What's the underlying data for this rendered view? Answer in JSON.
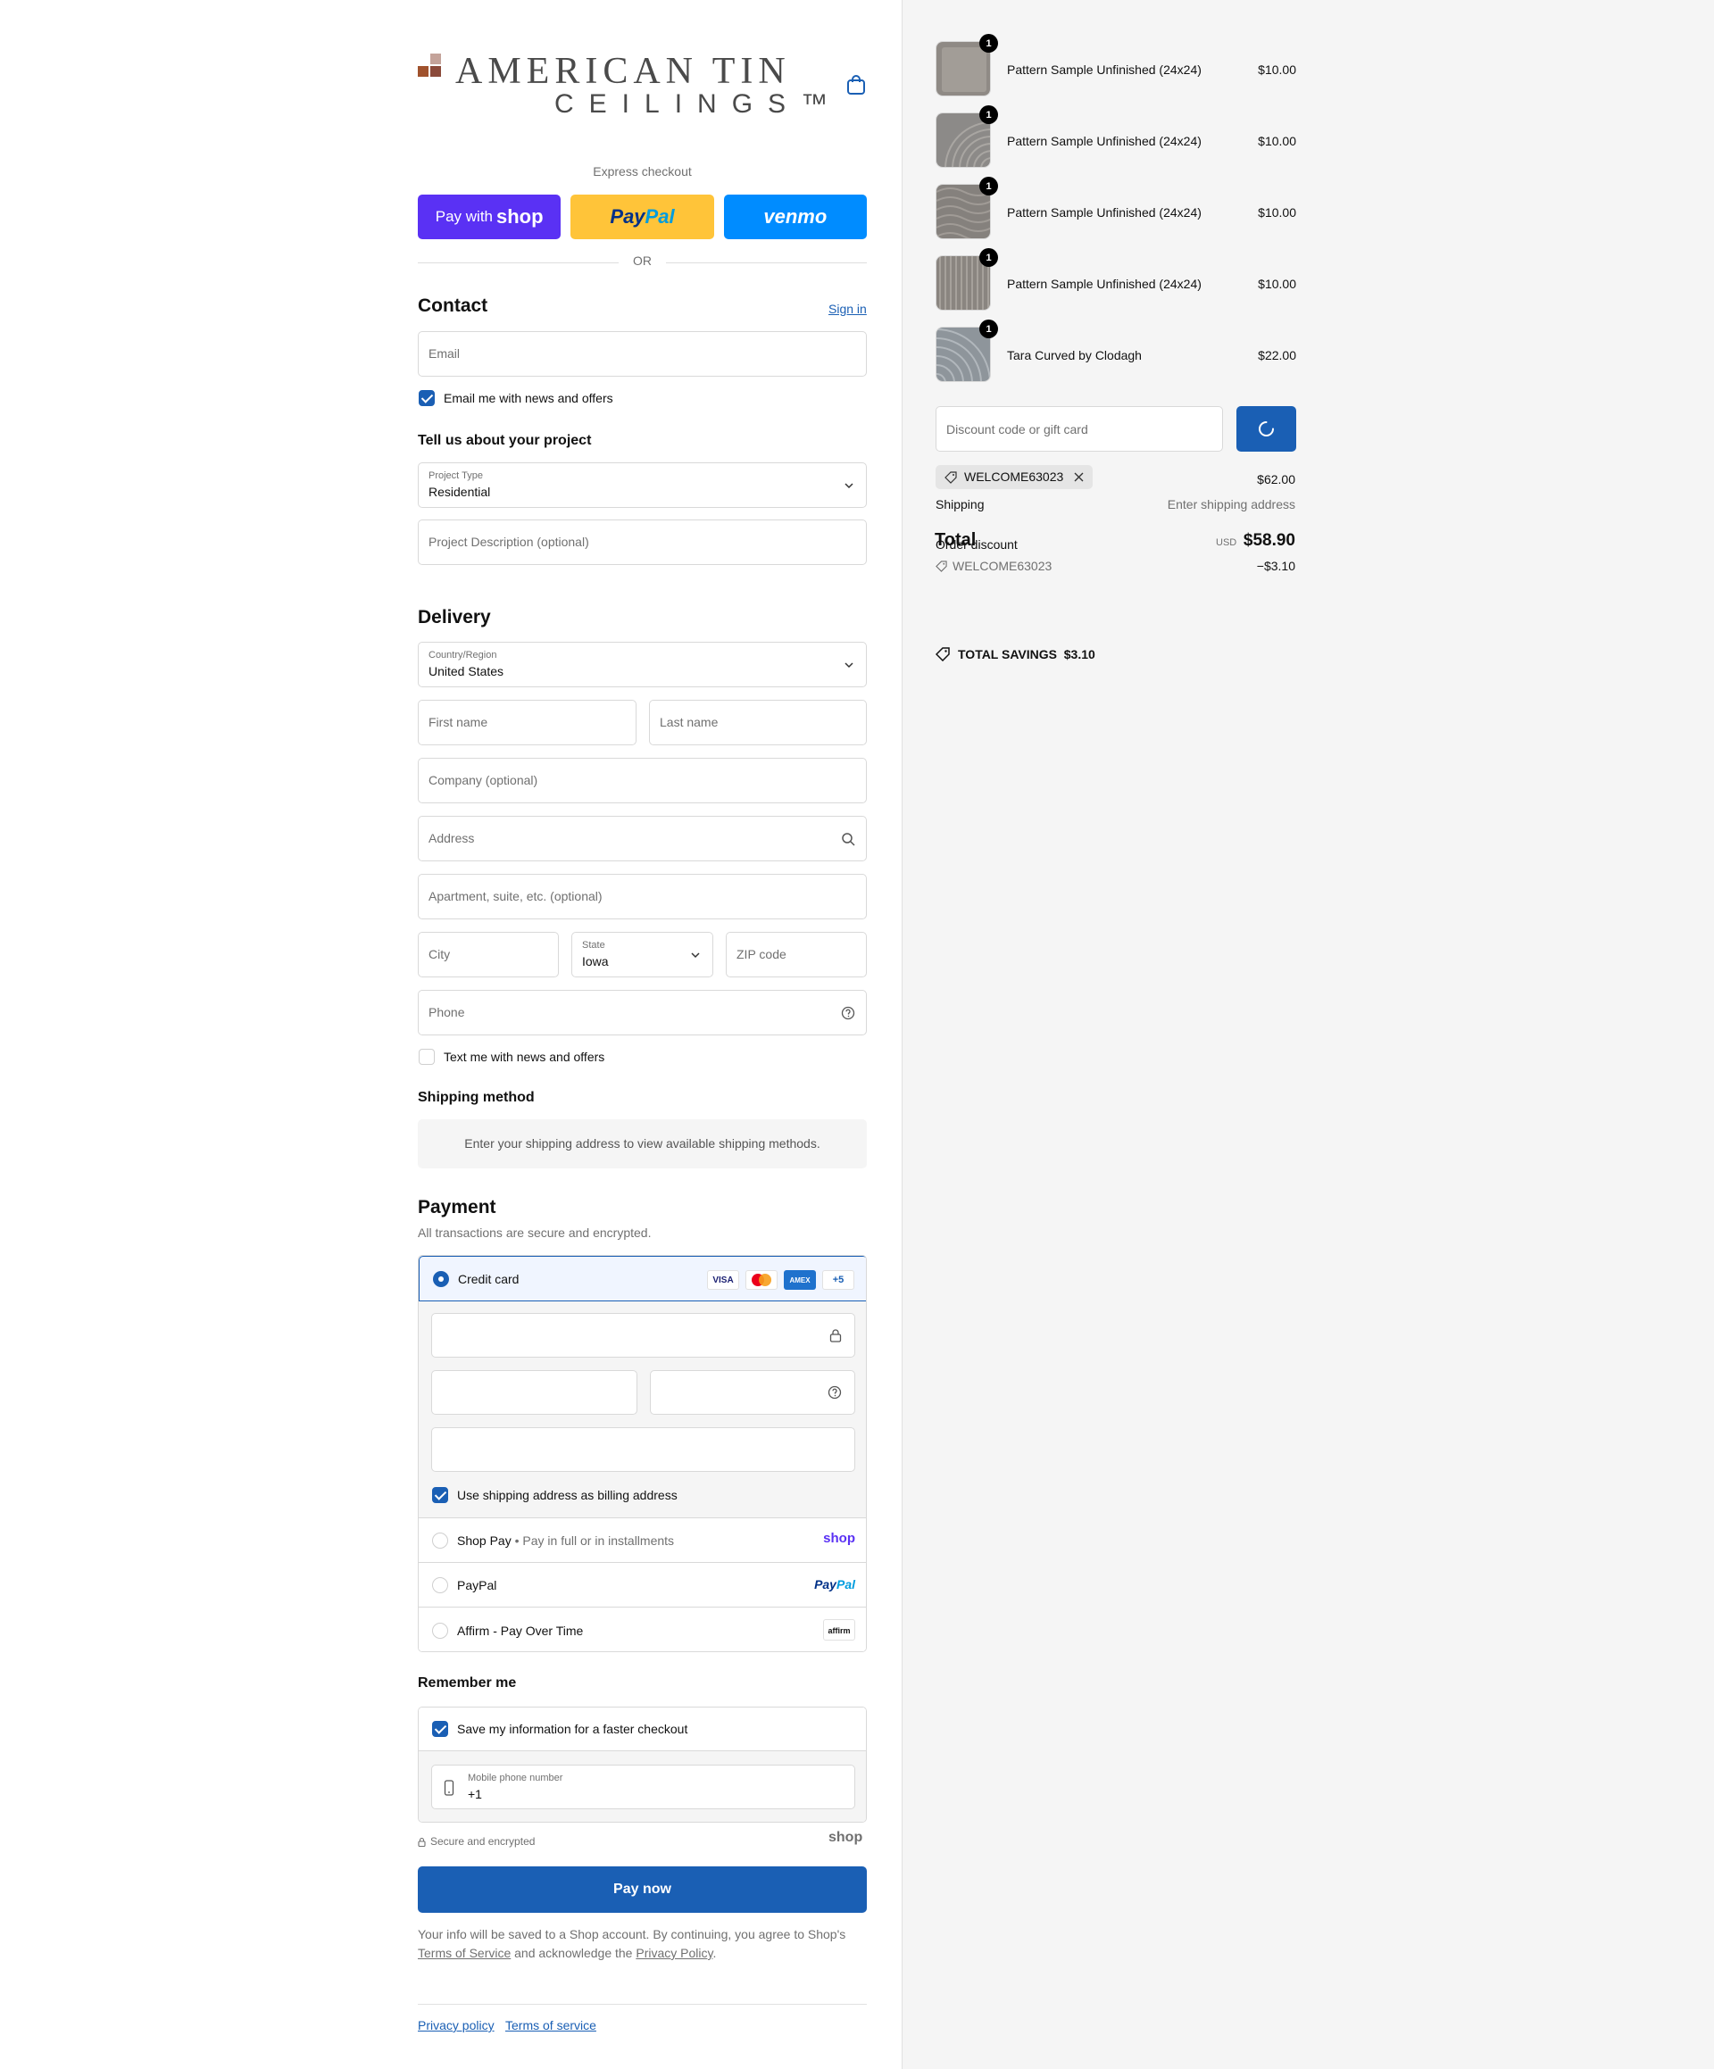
{
  "brand": {
    "line1": "AMERICAN TIN",
    "line2": "CEILINGS™",
    "logo_colors": [
      "#8b4a3a",
      "#c4a39a",
      "#a0522d"
    ]
  },
  "express": {
    "label": "Express checkout",
    "shop_prefix": "Pay with",
    "shop_word": "shop",
    "paypal_a": "Pay",
    "paypal_b": "Pal",
    "venmo": "venmo",
    "or": "OR"
  },
  "contact": {
    "title": "Contact",
    "sign_in": "Sign in",
    "email_placeholder": "Email",
    "news_label": "Email me with news and offers",
    "news_checked": true
  },
  "project": {
    "title": "Tell us about your project",
    "type_label": "Project Type",
    "type_value": "Residential",
    "desc_placeholder": "Project Description (optional)"
  },
  "delivery": {
    "title": "Delivery",
    "country_label": "Country/Region",
    "country_value": "United States",
    "first_name": "First name",
    "last_name": "Last name",
    "company": "Company (optional)",
    "address": "Address",
    "apartment": "Apartment, suite, etc. (optional)",
    "city": "City",
    "state_label": "State",
    "state_value": "Iowa",
    "zip": "ZIP code",
    "phone": "Phone",
    "text_label": "Text me with news and offers",
    "text_checked": false
  },
  "shipping": {
    "title": "Shipping method",
    "note": "Enter your shipping address to view available shipping methods."
  },
  "payment": {
    "title": "Payment",
    "subtitle": "All transactions are secure and encrypted.",
    "credit_card": "Credit card",
    "card_more": "+5",
    "card_brands": [
      "VISA",
      "MC",
      "AMEX"
    ],
    "billing_label": "Use shipping address as billing address",
    "shop_pay": "Shop Pay",
    "shop_pay_sub": "Pay in full or in installments",
    "shop_pay_logo": "shop",
    "paypal": "PayPal",
    "affirm": "Affirm - Pay Over Time",
    "affirm_logo": "affirm"
  },
  "remember": {
    "title": "Remember me",
    "save_label": "Save my information for a faster checkout",
    "mobile_label": "Mobile phone number",
    "mobile_value": "+1",
    "secure": "Secure and encrypted",
    "shop_logo": "shop"
  },
  "pay_now": "Pay now",
  "legal": {
    "text1": "Your info will be saved to a Shop account. By continuing, you agree to Shop's",
    "terms": "Terms of Service",
    "text2": "and acknowledge the",
    "privacy": "Privacy Policy",
    "text3": "."
  },
  "footer": {
    "privacy": "Privacy policy",
    "terms": "Terms of service"
  },
  "cart": {
    "items": [
      {
        "name": "Pattern Sample Unfinished (24x24)",
        "price": "$10.00",
        "qty": "1",
        "pattern": "plain"
      },
      {
        "name": "Pattern Sample Unfinished (24x24)",
        "price": "$10.00",
        "qty": "1",
        "pattern": "arcs"
      },
      {
        "name": "Pattern Sample Unfinished (24x24)",
        "price": "$10.00",
        "qty": "1",
        "pattern": "waves"
      },
      {
        "name": "Pattern Sample Unfinished (24x24)",
        "price": "$10.00",
        "qty": "1",
        "pattern": "lines"
      },
      {
        "name": "Tara Curved by Clodagh",
        "price": "$22.00",
        "qty": "1",
        "pattern": "curves"
      }
    ],
    "discount_placeholder": "Discount code or gift card",
    "code": "WELCOME63023",
    "subtotal_value": "$62.00",
    "shipping_label": "Shipping",
    "shipping_value": "Enter shipping address",
    "order_discount_label": "Order discount",
    "total_label": "Total",
    "currency": "USD",
    "total_value": "$58.90",
    "discount_code": "WELCOME63023",
    "discount_value": "−$3.10",
    "savings_label": "TOTAL SAVINGS",
    "savings_value": "$3.10"
  },
  "colors": {
    "accent": "#1a5fb4",
    "shop": "#5a31f4",
    "paypal": "#ffc439",
    "venmo": "#008cff"
  }
}
